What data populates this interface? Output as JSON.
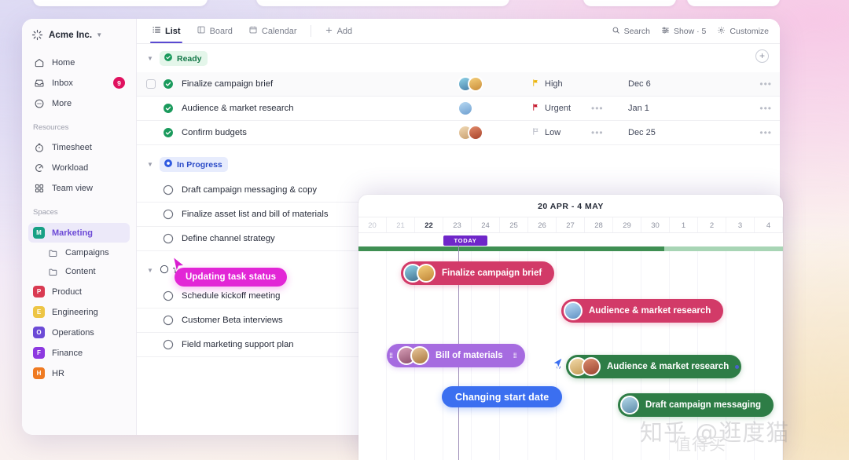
{
  "sidebar": {
    "brand": {
      "name": "Acme Inc.",
      "caret": "chevron-down-icon",
      "logo": "sparkle-logo"
    },
    "nav": [
      {
        "label": "Home",
        "icon": "home-icon",
        "badge": ""
      },
      {
        "label": "Inbox",
        "icon": "inbox-icon",
        "badge": "9"
      },
      {
        "label": "More",
        "icon": "more-icon",
        "badge": ""
      }
    ],
    "resources_label": "Resources",
    "resources": [
      {
        "label": "Timesheet",
        "icon": "timer-icon"
      },
      {
        "label": "Workload",
        "icon": "gauge-icon"
      },
      {
        "label": "Team view",
        "icon": "grid-icon"
      }
    ],
    "spaces_label": "Spaces",
    "spaces": [
      {
        "label": "Marketing",
        "initial": "M",
        "color": "#17a085",
        "active": true
      },
      {
        "label": "Product",
        "initial": "P",
        "color": "#d93a52",
        "active": false
      },
      {
        "label": "Engineering",
        "initial": "E",
        "color": "#edc545",
        "active": false
      },
      {
        "label": "Operations",
        "initial": "O",
        "color": "#6c4ad6",
        "active": false
      },
      {
        "label": "Finance",
        "initial": "F",
        "color": "#8d39e0",
        "active": false
      },
      {
        "label": "HR",
        "initial": "H",
        "color": "#ef7a22",
        "active": false
      }
    ],
    "marketing_children": [
      {
        "label": "Campaigns",
        "icon": "folder-icon"
      },
      {
        "label": "Content",
        "icon": "folder-icon"
      }
    ]
  },
  "toolbar": {
    "tabs": [
      {
        "label": "List",
        "icon": "list-icon",
        "active": true
      },
      {
        "label": "Board",
        "icon": "board-icon",
        "active": false
      },
      {
        "label": "Calendar",
        "icon": "calendar-icon",
        "active": false
      }
    ],
    "add_label": "Add",
    "add_icon": "plus-icon",
    "right": [
      {
        "label": "Search",
        "icon": "search-icon"
      },
      {
        "label": "Show · 5",
        "icon": "filter-icon"
      },
      {
        "label": "Customize",
        "icon": "gear-icon"
      }
    ]
  },
  "list": {
    "add_row_icon": "plus-circle-icon",
    "groups": [
      {
        "name": "Ready",
        "style": "ready",
        "icon": "check-circle-icon",
        "tasks": [
          {
            "name": "Finalize campaign brief",
            "status": "done",
            "priority": "High",
            "priority_color": "#eab308",
            "date": "Dec 6",
            "avatars": 2,
            "checkbox": true,
            "highlight": true,
            "mid_dots": ""
          },
          {
            "name": "Audience & market research",
            "status": "done",
            "priority": "Urgent",
            "priority_color": "#dc2626",
            "date": "Jan 1",
            "avatars": 1,
            "checkbox": false,
            "highlight": false,
            "mid_dots": "•••"
          },
          {
            "name": "Confirm budgets",
            "status": "done",
            "priority": "Low",
            "priority_color": "#b6b9c4",
            "date": "Dec 25",
            "avatars": 2,
            "checkbox": false,
            "highlight": false,
            "mid_dots": "•••"
          }
        ]
      },
      {
        "name": "In Progress",
        "style": "prog",
        "icon": "radio-dot-icon",
        "tasks": [
          {
            "name": "Draft campaign messaging & copy",
            "status": "open",
            "priority": "",
            "priority_color": "",
            "date": "",
            "avatars": 0,
            "checkbox": false,
            "highlight": false,
            "mid_dots": ""
          },
          {
            "name": "Finalize asset list and bill of materials",
            "status": "open",
            "priority": "",
            "priority_color": "",
            "date": "",
            "avatars": 0,
            "checkbox": false,
            "highlight": false,
            "mid_dots": ""
          },
          {
            "name": "Define channel strategy",
            "status": "open",
            "priority": "",
            "priority_color": "",
            "date": "",
            "avatars": 0,
            "checkbox": false,
            "highlight": false,
            "mid_dots": ""
          }
        ]
      },
      {
        "name": "To Do",
        "style": "todo",
        "icon": "circle-icon",
        "tasks": [
          {
            "name": "Schedule kickoff meeting",
            "status": "open",
            "priority": "",
            "priority_color": "",
            "date": "",
            "avatars": 0,
            "checkbox": false,
            "highlight": false,
            "mid_dots": ""
          },
          {
            "name": "Customer Beta interviews",
            "status": "open",
            "priority": "",
            "priority_color": "",
            "date": "",
            "avatars": 0,
            "checkbox": false,
            "highlight": false,
            "mid_dots": ""
          },
          {
            "name": "Field marketing support plan",
            "status": "open",
            "priority": "",
            "priority_color": "",
            "date": "",
            "avatars": 0,
            "checkbox": false,
            "highlight": false,
            "mid_dots": ""
          }
        ]
      }
    ]
  },
  "tooltips": {
    "updating_status": "Updating task status",
    "changing_start_date": "Changing start date"
  },
  "gantt": {
    "title": "20 APR - 4 MAY",
    "today_label": "TODAY",
    "days": [
      "20",
      "21",
      "22",
      "23",
      "24",
      "25",
      "26",
      "27",
      "28",
      "29",
      "30",
      "1",
      "2",
      "3",
      "4"
    ],
    "today_index": 2,
    "dim_days": [
      "20",
      "21"
    ],
    "progress_percent": 72,
    "bars": [
      {
        "label": "Finalize campaign brief",
        "color": "crimson",
        "avatars": 2,
        "handles": false
      },
      {
        "label": "Audience & market research",
        "color": "crimson",
        "avatars": 1,
        "handles": false
      },
      {
        "label": "Bill of materials",
        "color": "purple",
        "avatars": 2,
        "handles": true
      },
      {
        "label": "Audience & market research",
        "color": "green",
        "avatars": 2,
        "handles": false
      },
      {
        "label": "Draft campaign messaging",
        "color": "green",
        "avatars": 1,
        "handles": false
      }
    ]
  },
  "watermark": {
    "line1": "知乎 @逛度猫",
    "line2": "值得买"
  },
  "colors": {
    "accent": "#5a4ad1",
    "ready": "#16794a",
    "in_progress": "#2a4ac7",
    "badge": "#e0115f",
    "today": "#6f26c9",
    "tip_magenta": "#e226d6",
    "tip_blue": "#3b6ff0"
  }
}
